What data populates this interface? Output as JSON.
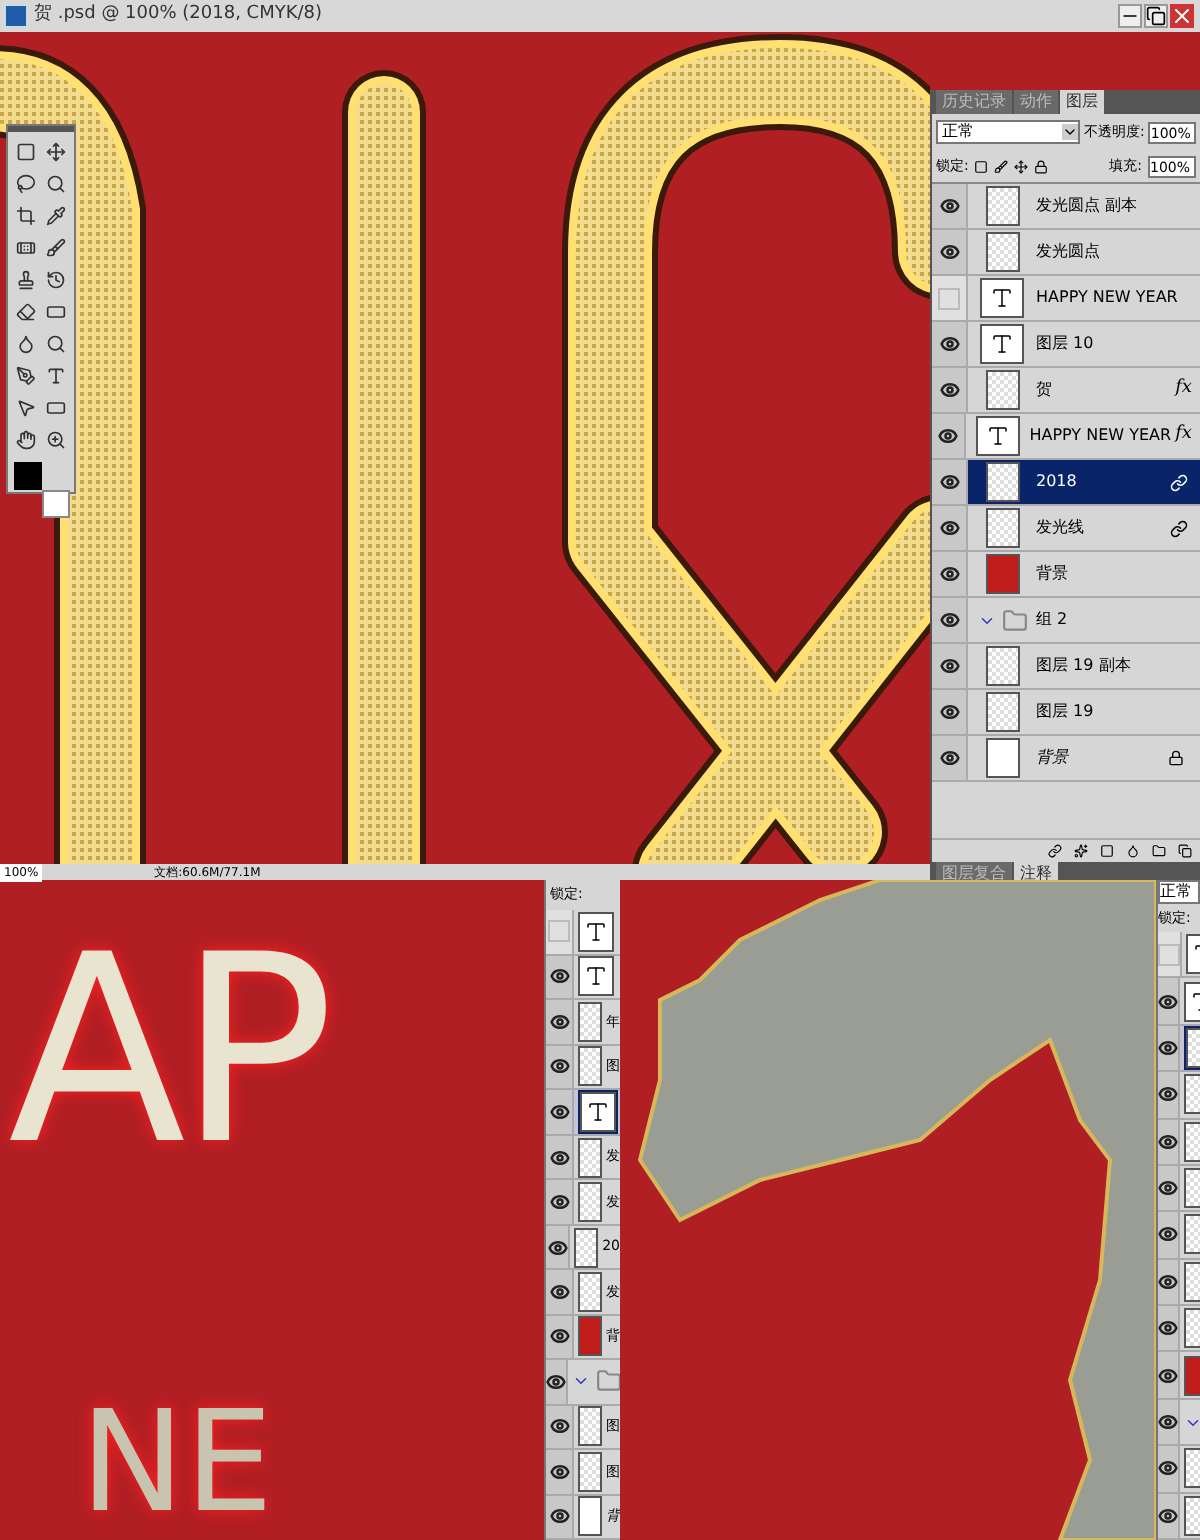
{
  "window": {
    "title": "贺 .psd @ 100% (2018, CMYK/8)"
  },
  "layers_panel": {
    "tabs": [
      {
        "label": "历史记录",
        "selected": false
      },
      {
        "label": "动作",
        "selected": false
      },
      {
        "label": "图层",
        "selected": true
      }
    ],
    "blend_mode": "正常",
    "opacity_label": "不透明度:",
    "opacity": "100%",
    "lock_label": "锁定:",
    "fill_label": "填充:",
    "fill": "100%",
    "layers": [
      {
        "kind": "raster",
        "name": "发光圆点 副本",
        "visible": true,
        "selected": false,
        "linked": false,
        "locked": false
      },
      {
        "kind": "raster",
        "name": "发光圆点",
        "visible": true,
        "selected": false,
        "linked": false,
        "locked": false
      },
      {
        "kind": "text",
        "name": "HAPPY NEW YEAR",
        "visible": false,
        "selected": false,
        "linked": false,
        "locked": false
      },
      {
        "kind": "text",
        "name": "图层 10",
        "visible": true,
        "selected": false,
        "linked": false,
        "locked": false
      },
      {
        "kind": "raster",
        "name": "贺",
        "effects": "fx",
        "visible": true,
        "selected": false,
        "linked": false,
        "locked": false
      },
      {
        "kind": "text",
        "name": "HAPPY NEW YEAR",
        "effects": "fx",
        "visible": true,
        "selected": false,
        "linked": false,
        "locked": false
      },
      {
        "kind": "raster",
        "name": "2018",
        "visible": true,
        "selected": true,
        "linked": true,
        "locked": false
      },
      {
        "kind": "raster",
        "name": "发光线",
        "visible": true,
        "selected": false,
        "linked": true,
        "locked": false
      },
      {
        "kind": "fill",
        "name": "背景",
        "visible": true,
        "selected": false,
        "linked": false,
        "locked": false
      },
      {
        "kind": "group",
        "name": "组 2",
        "visible": true,
        "selected": false,
        "linked": false,
        "locked": false
      },
      {
        "kind": "raster",
        "name": "图层 19 副本",
        "visible": true,
        "selected": false,
        "linked": false,
        "locked": false
      },
      {
        "kind": "raster",
        "name": "图层 19",
        "visible": true,
        "selected": false,
        "linked": false,
        "locked": false
      },
      {
        "kind": "background",
        "name": "背景",
        "visible": true,
        "selected": false,
        "linked": false,
        "locked": true
      }
    ],
    "bottom_tabs": [
      {
        "label": "图层复合",
        "selected": false
      },
      {
        "label": "注释",
        "selected": true
      }
    ]
  },
  "status_bar": {
    "zoom": "100%",
    "document": "文档:60.6M/77.1M"
  },
  "detail_left": {
    "letters_top": "AP",
    "letters_bottom": "NE",
    "lock_label": "锁定:",
    "layers": [
      {
        "kind": "text",
        "visible": false,
        "selected": false
      },
      {
        "kind": "text",
        "visible": true,
        "selected": false
      },
      {
        "kind": "raster",
        "name": "年",
        "visible": true,
        "selected": false
      },
      {
        "kind": "raster",
        "name": "图",
        "visible": true,
        "selected": false
      },
      {
        "kind": "text",
        "visible": true,
        "selected": true
      },
      {
        "kind": "raster",
        "name": "发",
        "visible": true,
        "selected": false
      },
      {
        "kind": "raster",
        "name": "发",
        "visible": true,
        "selected": false
      },
      {
        "kind": "raster",
        "name": "20",
        "visible": true,
        "selected": false
      },
      {
        "kind": "raster",
        "name": "发",
        "visible": true,
        "selected": false
      },
      {
        "kind": "fill",
        "name": "背",
        "visible": true,
        "selected": false
      },
      {
        "kind": "group",
        "visible": true,
        "selected": false
      },
      {
        "kind": "raster",
        "name": "图",
        "visible": true,
        "selected": false
      },
      {
        "kind": "raster",
        "name": "图",
        "visible": true,
        "selected": false
      },
      {
        "kind": "background",
        "name": "背",
        "visible": true,
        "selected": false
      }
    ]
  },
  "detail_right": {
    "blend_mode": "正常",
    "lock_label": "锁定:",
    "layers": [
      {
        "kind": "text",
        "visible": false,
        "selected": false
      },
      {
        "kind": "text",
        "visible": true,
        "selected": false
      },
      {
        "kind": "raster",
        "visible": true,
        "selected": true
      },
      {
        "kind": "raster",
        "visible": true,
        "selected": false
      },
      {
        "kind": "raster",
        "visible": true,
        "selected": false
      },
      {
        "kind": "raster",
        "visible": true,
        "selected": false
      },
      {
        "kind": "raster",
        "visible": true,
        "selected": false
      },
      {
        "kind": "raster",
        "visible": true,
        "selected": false
      },
      {
        "kind": "raster",
        "visible": true,
        "selected": false
      },
      {
        "kind": "fill",
        "visible": true,
        "selected": false
      },
      {
        "kind": "group",
        "visible": true,
        "selected": false
      },
      {
        "kind": "raster",
        "visible": true,
        "selected": false
      },
      {
        "kind": "raster",
        "visible": true,
        "selected": false
      }
    ]
  }
}
